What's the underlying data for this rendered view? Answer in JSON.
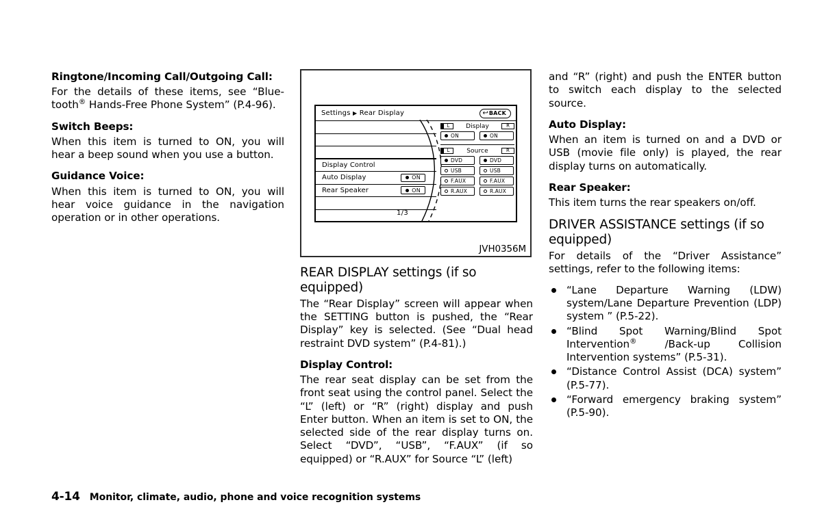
{
  "left_column": {
    "sections": [
      {
        "heading": "Ringtone/Incoming Call/Outgoing Call:",
        "body_pre": "For the details of these items, see “Blue-tooth",
        "body_post": " Hands-Free Phone System” (P.4-96).",
        "has_registered_mark": true
      },
      {
        "heading": "Switch Beeps:",
        "body": "When this item is turned to ON, you will hear a beep sound when you use a button."
      },
      {
        "heading": "Guidance Voice:",
        "body": "When this item is turned to ON, you will hear voice guidance in the navigation operation or in other operations."
      }
    ]
  },
  "figure": {
    "id_label": "JVH0356M",
    "screen": {
      "breadcrumb_root": "Settings",
      "breadcrumb_arrow": "▶",
      "breadcrumb_current": "Rear Display",
      "back_button_label": "BACK",
      "back_button_glyph": "↩",
      "menu_rows": [
        {
          "label": "",
          "value": ""
        },
        {
          "label": "",
          "value": ""
        },
        {
          "label": "Display Control",
          "value": ""
        },
        {
          "label": "Auto Display",
          "value": "ON"
        },
        {
          "label": "Rear Speaker",
          "value": "ON"
        },
        {
          "label": "",
          "value": ""
        }
      ],
      "page_indicator": "1/3",
      "display_group": {
        "title": "Display",
        "left_key": "L",
        "right_key": "R",
        "left_option": {
          "label": "ON",
          "selected": true
        },
        "right_option": {
          "label": "ON",
          "selected": true
        }
      },
      "source_group": {
        "title": "Source",
        "left_key": "L",
        "right_key": "R",
        "left_options": [
          {
            "label": "DVD",
            "selected": true
          },
          {
            "label": "USB",
            "selected": false
          },
          {
            "label": "F.AUX",
            "selected": false
          },
          {
            "label": "R.AUX",
            "selected": false
          }
        ],
        "right_options": [
          {
            "label": "DVD",
            "selected": true
          },
          {
            "label": "USB",
            "selected": false
          },
          {
            "label": "F.AUX",
            "selected": false
          },
          {
            "label": "R.AUX",
            "selected": false
          }
        ]
      }
    }
  },
  "middle_column": {
    "heading": "REAR DISPLAY settings (if so equipped)",
    "intro": "The “Rear Display” screen will appear when the SETTING button is pushed, the “Rear Display” key is selected. (See “Dual head restraint DVD system” (P.4-81).)",
    "subheading": "Display Control:",
    "body": "The rear seat display can be set from the front seat using the control panel. Select the “L” (left) or “R” (right) display and push Enter button. When an item is set to ON, the selected side of the rear display turns on. Select “DVD”, “USB”, “F.AUX” (if so equipped) or “R.AUX” for Source “L” (left)"
  },
  "right_column": {
    "continuation": "and “R” (right) and push the ENTER button to switch each display to the selected source.",
    "auto_display_heading": "Auto Display:",
    "auto_display_body": "When an item is turned on and a DVD or USB (movie file only) is played, the rear display turns on automatically.",
    "rear_speaker_heading": "Rear Speaker:",
    "rear_speaker_body": "This item turns the rear speakers on/off.",
    "driver_assist_heading": "DRIVER ASSISTANCE settings (if so equipped)",
    "driver_assist_intro": "For details of the “Driver Assistance” settings, refer to the following items:",
    "bullets": [
      {
        "text": "“Lane Departure Warning (LDW) system/Lane Departure Prevention (LDP) system ” (P.5-22).",
        "has_registered_mark": false
      },
      {
        "text_pre": "“Blind Spot Warning/Blind Spot Intervention",
        "text_post": " /Back-up Collision Intervention systems” (P.5-31).",
        "has_registered_mark": true
      },
      {
        "text": "“Distance Control Assist (DCA) system” (P.5-77).",
        "has_registered_mark": false
      },
      {
        "text": "“Forward emergency braking system” (P.5-90).",
        "has_registered_mark": false
      }
    ]
  },
  "footer": {
    "page_number": "4-14",
    "section_title": "Monitor, climate, audio, phone and voice recognition systems"
  }
}
